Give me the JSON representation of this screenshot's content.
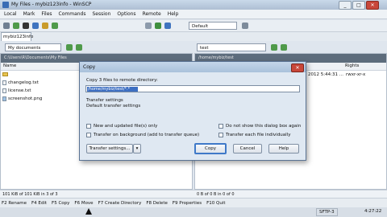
{
  "window": {
    "title": "My Files - mybiz123info - WinSCP",
    "controls": [
      "_",
      "□",
      "✕"
    ]
  },
  "menu": [
    "Local",
    "Mark",
    "Files",
    "Commands",
    "Session",
    "Options",
    "Remote",
    "Help"
  ],
  "toolbar": {
    "transfer_setting": "Default"
  },
  "session_tab": "mybiz123info",
  "left_panel": {
    "location": "My documents",
    "path": "C:\\Users\\R\\Documents\\My Files",
    "column_name": "Name",
    "files": [
      {
        "name": "changelog.txt",
        "icon": "file-icon"
      },
      {
        "name": "license.txt",
        "icon": "file-icon"
      },
      {
        "name": "screenshot.png",
        "icon": "image-icon"
      }
    ],
    "status": "101 KiB of 101 KiB in 3 of 3"
  },
  "right_panel": {
    "location": "test",
    "path": "/home/mybiz/test",
    "column_rights": "Rights",
    "row_date": "2012 5:44:31 ...",
    "row_rights": "rwxr-xr-x",
    "status": "0 B of 0 B in 0 of 0"
  },
  "dialog": {
    "title": "Copy",
    "close_label": "✕",
    "prompt": "Copy 3 files to remote directory:",
    "target_value": "/home/mybiz/test/*.*",
    "transfer_settings_heading": "Transfer settings",
    "transfer_settings_value": "Default transfer settings",
    "options": {
      "new_updated_only": "New and updated file(s) only",
      "background": "Transfer on background (add to transfer queue)",
      "dont_show": "Do not show this dialog box again",
      "transfer_individually": "Transfer each file individually"
    },
    "buttons": {
      "transfer_settings": "Transfer settings...",
      "copy": "Copy",
      "cancel": "Cancel",
      "help": "Help"
    }
  },
  "fkeys": [
    "F2 Rename",
    "F4 Edit",
    "F5 Copy",
    "F6 Move",
    "F7 Create Directory",
    "F8 Delete",
    "F9 Properties",
    "F10 Quit"
  ],
  "statusbar": {
    "protocol": "SFTP-3",
    "clock": "4:27:22"
  },
  "colors": {
    "titlebar": "#aebfd3",
    "dialog_bg": "#dfe8f2",
    "selection": "#3d6fc2",
    "close": "#c8473a"
  }
}
